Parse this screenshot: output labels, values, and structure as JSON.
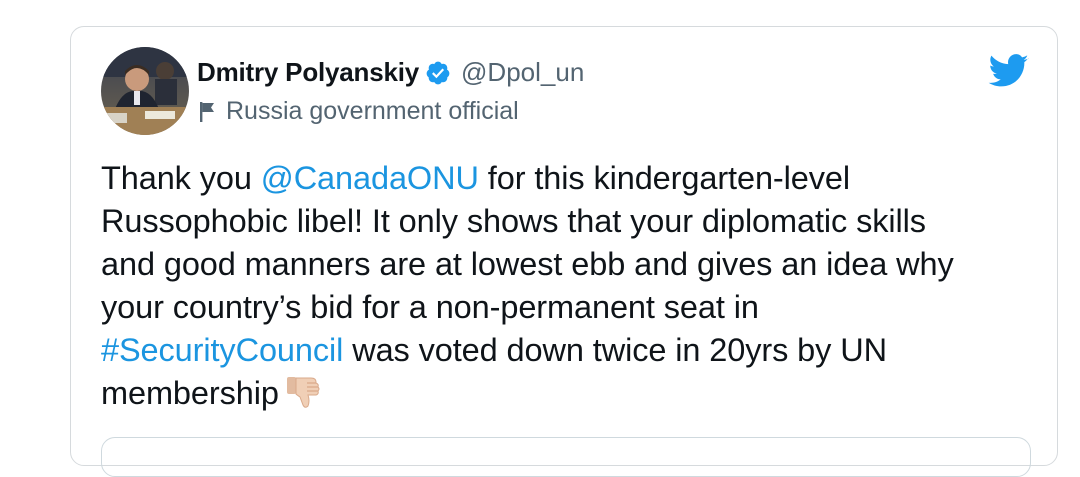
{
  "tweet": {
    "author": {
      "display_name": "Dmitry Polyanskiy",
      "handle": "@Dpol_un",
      "verified": true,
      "label": "Russia government official"
    },
    "text_lines": [
      [
        {
          "text": "Thank you ",
          "type": "text"
        },
        {
          "text": "@CanadaONU",
          "type": "mention"
        },
        {
          "text": " for this kindergarten-level",
          "type": "text"
        }
      ],
      [
        {
          "text": "Russophobic libel! It only shows that your diplomatic skills",
          "type": "text"
        }
      ],
      [
        {
          "text": "and good manners are at lowest ebb and gives an idea why",
          "type": "text"
        }
      ],
      [
        {
          "text": "your country’s bid for a non-permanent seat in",
          "type": "text"
        }
      ],
      [
        {
          "text": "#SecurityCouncil",
          "type": "hashtag"
        },
        {
          "text": " was voted down twice in 20yrs by UN",
          "type": "text"
        }
      ],
      [
        {
          "text": "membership",
          "type": "text"
        }
      ]
    ],
    "trailing_emoji": "thumbs-down-icon"
  },
  "colors": {
    "link": "#1b95e0",
    "text": "#0f1419",
    "secondary": "#536471",
    "twitter_blue": "#1d9bf0"
  },
  "icons": {
    "verified": "verified-badge-icon",
    "label": "flag-icon",
    "brand": "twitter-bird-icon"
  }
}
